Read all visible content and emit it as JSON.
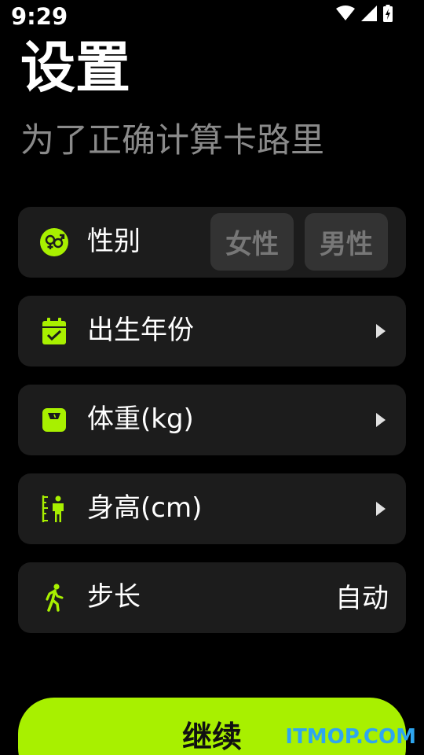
{
  "status_bar": {
    "time": "9:29"
  },
  "header": {
    "title": "设置",
    "subtitle": "为了正确计算卡路里"
  },
  "colors": {
    "accent": "#a8f000",
    "row_bg": "#1c1c1c",
    "button_bg": "#333333",
    "subtitle": "#8a8a8a"
  },
  "rows": {
    "gender": {
      "label": "性别",
      "icon": "gender-icon",
      "options": [
        "女性",
        "男性"
      ]
    },
    "birth_year": {
      "label": "出生年份",
      "icon": "calendar-check-icon"
    },
    "weight": {
      "label": "体重(kg)",
      "icon": "scale-icon"
    },
    "height": {
      "label": "身高(cm)",
      "icon": "height-ruler-icon"
    },
    "stride": {
      "label": "步长",
      "icon": "walking-icon",
      "value": "自动"
    }
  },
  "continue_button": {
    "label": "继续"
  },
  "watermark": "ITMOP.COM"
}
